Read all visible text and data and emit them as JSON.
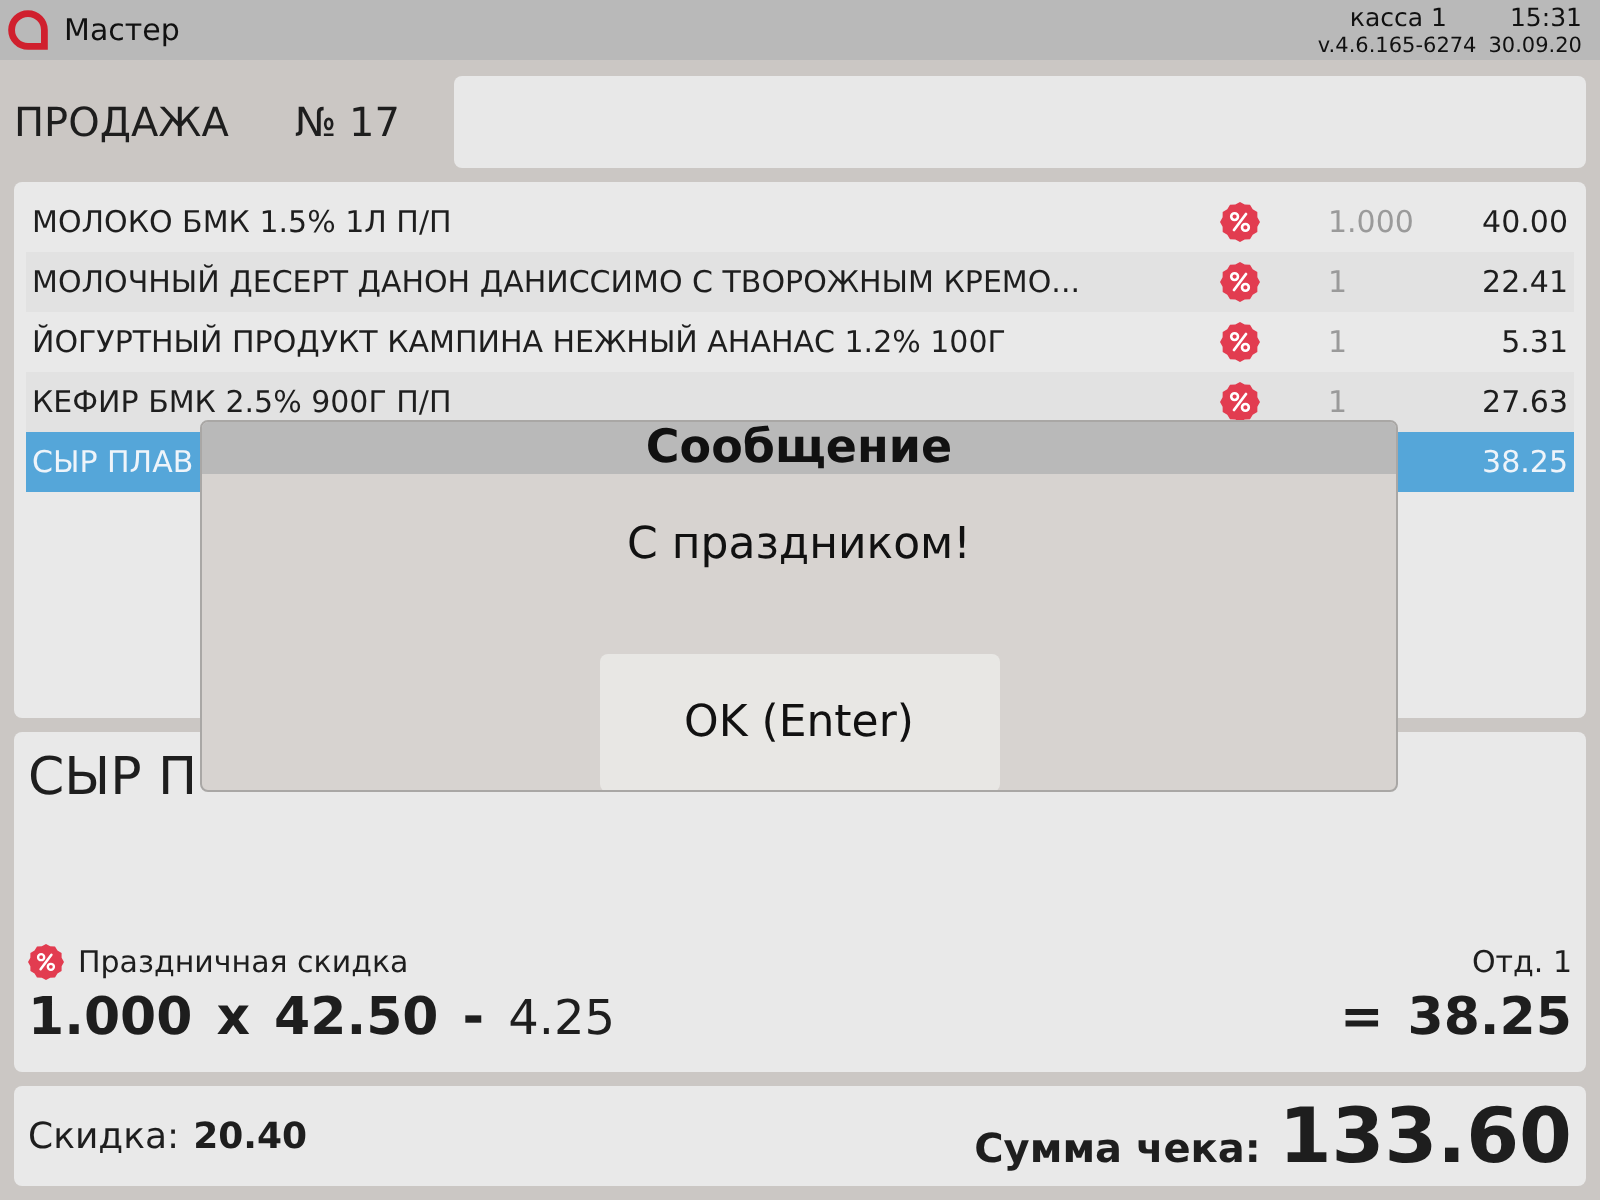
{
  "top_bar": {
    "app_name": "Мастер",
    "register": "касса 1",
    "time": "15:31",
    "version": "v.4.6.165-6274",
    "date": "30.09.20"
  },
  "sale": {
    "title": "ПРОДАЖА",
    "number": "№ 17"
  },
  "items": [
    {
      "name": "МОЛОКО БМК 1.5% 1Л П/П",
      "discount": true,
      "quantity": "1.000",
      "price": "40.00",
      "selected": false
    },
    {
      "name": "МОЛОЧНЫЙ ДЕСЕРТ ДАНОН ДАНИССИМО С ТВОРОЖНЫМ КРЕМО...",
      "discount": true,
      "quantity": "1",
      "price": "22.41",
      "selected": false
    },
    {
      "name": "ЙОГУРТНЫЙ ПРОДУКТ КАМПИНА НЕЖНЫЙ АНАНАС 1.2% 100Г",
      "discount": true,
      "quantity": "1",
      "price": "5.31",
      "selected": false
    },
    {
      "name": "КЕФИР БМК 2.5% 900Г П/П",
      "discount": true,
      "quantity": "1",
      "price": "27.63",
      "selected": false
    },
    {
      "name": "СЫР ПЛАВ",
      "price": "38.25",
      "selected": true
    }
  ],
  "detail": {
    "title": "СЫР П",
    "discount_name": "Праздничная скидка",
    "department": "Отд. 1",
    "quantity": "1.000",
    "times": "x",
    "price": "42.50",
    "minus": "-",
    "discount": "4.25",
    "equals": "=",
    "total": "38.25"
  },
  "footer": {
    "discount_label": "Скидка:",
    "discount_value": "20.40",
    "total_label": "Сумма чека:",
    "total_value": "133.60"
  },
  "dialog": {
    "title": "Сообщение",
    "message": "С праздником!",
    "button": "OK (Enter)"
  }
}
